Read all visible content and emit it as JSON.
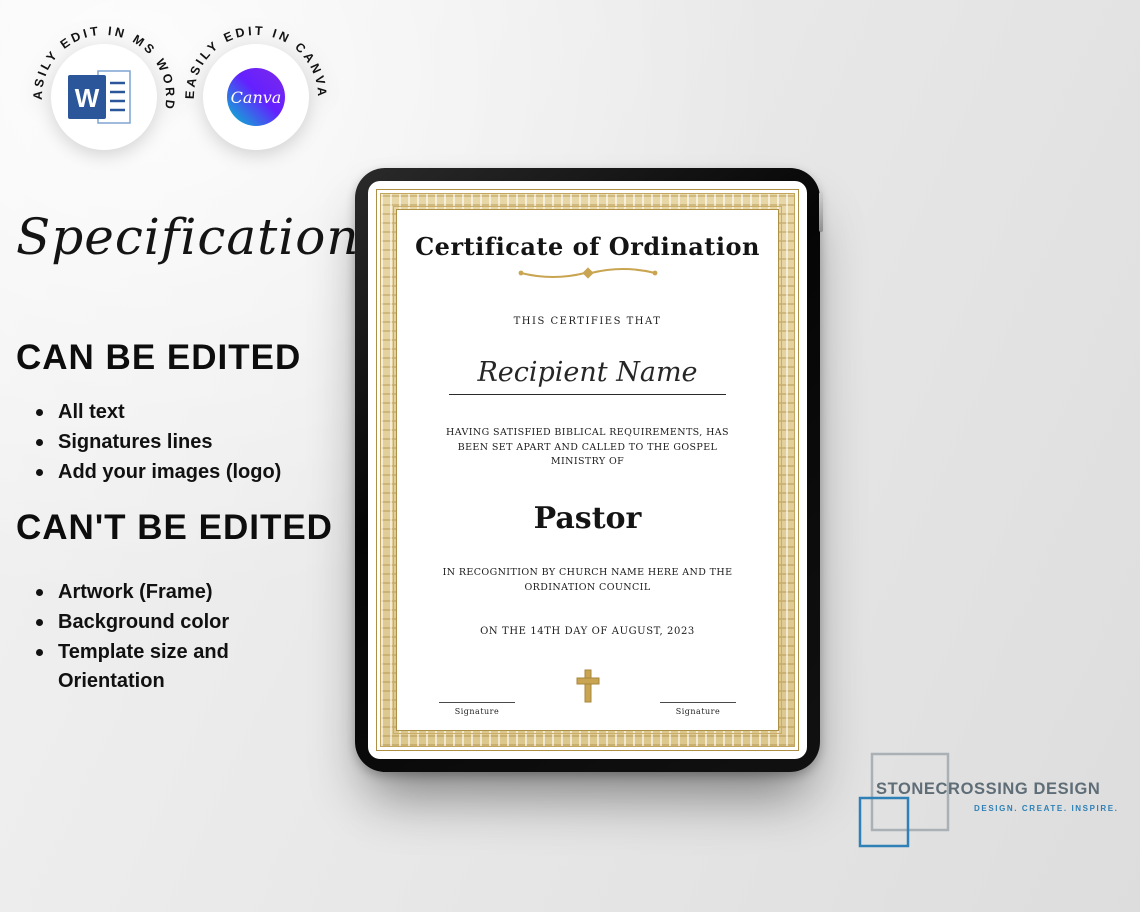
{
  "colors": {
    "gold": "#c9a552",
    "gold_dark": "#ad8f45",
    "word_blue": "#2b579a",
    "canva_teal": "#00c4cc",
    "canva_purple": "#7d2ae8",
    "brand_gray": "#5f6d77",
    "brand_blue": "#2e80b6"
  },
  "badges": {
    "word": {
      "ring_text": "EASILY EDIT IN MS WORD",
      "logo_letter": "W"
    },
    "canva": {
      "ring_text": "EASILY EDIT IN CANVA",
      "logo_text": "Canva"
    }
  },
  "specification": {
    "title": "Specification",
    "can_edit": {
      "heading": "CAN BE EDITED",
      "items": [
        "All text",
        "Signatures lines",
        "Add your images (logo)"
      ]
    },
    "cant_edit": {
      "heading": "CAN'T BE EDITED",
      "items": [
        "Artwork (Frame)",
        "Background color",
        "Template size and Orientation"
      ]
    }
  },
  "certificate": {
    "title": "Certificate of Ordination",
    "certifies_line": "THIS CERTIFIES THAT",
    "recipient_name": "Recipient Name",
    "body_top": "HAVING SATISFIED BIBLICAL REQUIREMENTS, HAS BEEN SET APART AND CALLED TO THE GOSPEL MINISTRY OF",
    "role": "Pastor",
    "body_bottom": "IN RECOGNITION BY CHURCH NAME HERE AND THE ORDINATION COUNCIL",
    "date_line": "ON THE 14TH DAY OF AUGUST, 2023",
    "signature_label_left": "Signature",
    "signature_label_right": "Signature"
  },
  "brand": {
    "name": "STONECROSSING DESIGN",
    "tagline": "DESIGN. CREATE. INSPIRE."
  }
}
